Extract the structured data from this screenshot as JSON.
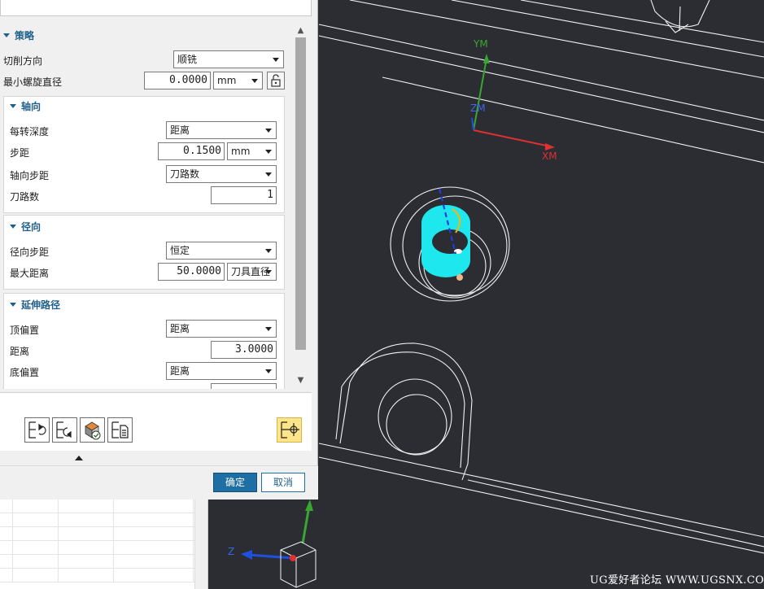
{
  "strategy": {
    "title": "策略",
    "cut_direction": {
      "label": "切削方向",
      "value": "顺铣"
    },
    "min_helix_diameter": {
      "label": "最小螺旋直径",
      "value": "0.0000",
      "unit": "mm"
    }
  },
  "axial": {
    "title": "轴向",
    "depth_per_rev": {
      "label": "每转深度",
      "value": "距离"
    },
    "step": {
      "label": "步距",
      "value": "0.1500",
      "unit": "mm"
    },
    "axial_step": {
      "label": "轴向步距",
      "value": "刀路数"
    },
    "num_passes": {
      "label": "刀路数",
      "value": "1"
    }
  },
  "radial": {
    "title": "径向",
    "radial_step": {
      "label": "径向步距",
      "value": "恒定"
    },
    "max_distance": {
      "label": "最大距离",
      "value": "50.0000",
      "unit": "刀具直径"
    }
  },
  "extend_path": {
    "title": "延伸路径",
    "top_offset": {
      "label": "顶偏置",
      "value": "距离"
    },
    "distance": {
      "label": "距离",
      "value": "3.0000"
    },
    "bottom_offset": {
      "label": "底偏置",
      "value": "距离"
    }
  },
  "footer": {
    "ok": "确定",
    "cancel": "取消"
  },
  "viewport": {
    "wcs_labels": {
      "y": "YM",
      "z": "ZM",
      "x": "XM"
    },
    "triad_labels": {
      "z": "Z"
    },
    "watermark": "UG爱好者论坛 WWW.UGSNX.COM",
    "colors": {
      "background": "#2b2d33",
      "wire": "#f2f2f2",
      "cyan": "#1fe7ee",
      "x_axis": "#e03030",
      "y_axis": "#3aa632",
      "z_axis": "#1e50e0"
    }
  }
}
